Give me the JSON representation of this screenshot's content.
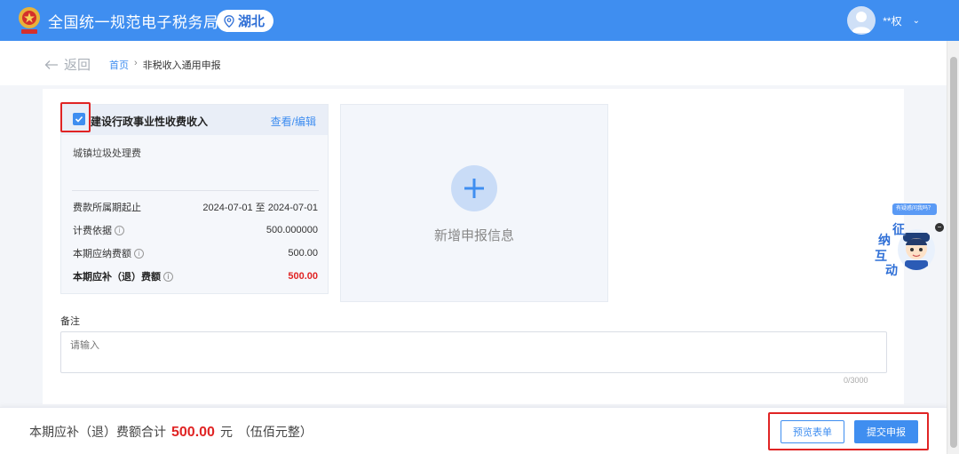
{
  "header": {
    "site_title": "全国统一规范电子税务局",
    "region": "湖北",
    "user_name": "**权"
  },
  "breadcrumb": {
    "back_label": "返回",
    "home": "首页",
    "separator": "›",
    "current": "非税收入通用申报"
  },
  "fee_card": {
    "checked": true,
    "title": "建设行政事业性收费收入",
    "edit_label": "查看/编辑",
    "subtitle": "城镇垃圾处理费",
    "rows": [
      {
        "label": "费款所属期起止",
        "value": "2024-07-01 至 2024-07-01"
      },
      {
        "label": "计费依据",
        "value": "500.000000"
      },
      {
        "label": "本期应纳费额",
        "value": "500.00"
      },
      {
        "label": "本期应补（退）费额",
        "value": "500.00"
      }
    ]
  },
  "add_card": {
    "label": "新增申报信息"
  },
  "note": {
    "label": "备注",
    "placeholder": "请输入",
    "counter": "0/3000"
  },
  "helper": {
    "tip": "有疑惑问我吗？",
    "chars": [
      "征",
      "纳",
      "互",
      "动"
    ],
    "close": "−"
  },
  "bottom": {
    "total_prefix": "本期应补（退）费额合计",
    "total_amount": "500.00",
    "total_unit": "元",
    "total_words": "（伍佰元整）",
    "preview_label": "预览表单",
    "submit_label": "提交申报"
  },
  "colors": {
    "brand": "#3f8ef0",
    "highlight": "#e02424"
  }
}
